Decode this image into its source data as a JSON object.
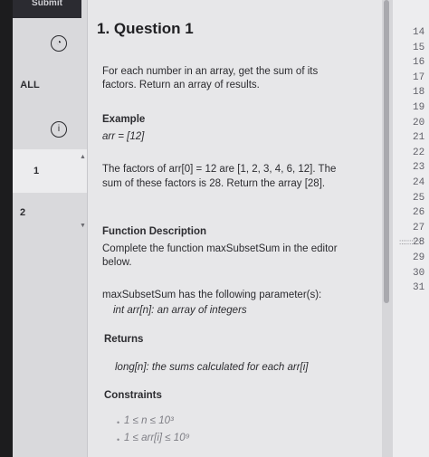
{
  "topbar": {
    "label": "Submit"
  },
  "sidebar": {
    "all_label": "ALL",
    "item_1": "1",
    "item_2": "2",
    "info_icon_glyph": "i"
  },
  "question": {
    "title": "1. Question 1",
    "description": "For each number in an array, get the sum of its factors. Return an array of results.",
    "example_heading": "Example",
    "example_arr": "arr = [12]",
    "factors_line1": "The factors of arr[0] = 12 are [1, 2, 3, 4, 6, 12]. The",
    "factors_line2": "sum of these factors is 28. Return the array [28].",
    "function_heading": "Function Description",
    "function_line1": "Complete the function maxSubsetSum in the editor",
    "function_line2": "below.",
    "params_line": "maxSubsetSum has the following parameter(s):",
    "param_arr": "int arr[n]:  an array of integers",
    "returns_heading": "Returns",
    "returns_line": "long[n]:  the sums calculated for each arr[i]",
    "constraints_heading": "Constraints",
    "constraint1": "1 ≤ n ≤ 10³",
    "constraint2": "1 ≤ arr[i] ≤ 10⁹"
  },
  "editor": {
    "line_numbers": [
      "14",
      "15",
      "16",
      "17",
      "18",
      "19",
      "20",
      "21",
      "22",
      "23",
      "24",
      "25",
      "26",
      "27",
      "28",
      "29",
      "30",
      "31"
    ]
  },
  "colors": {
    "sidebar": "#d9d9dc",
    "content": "#e7e7e9",
    "text": "#2c2c30"
  }
}
